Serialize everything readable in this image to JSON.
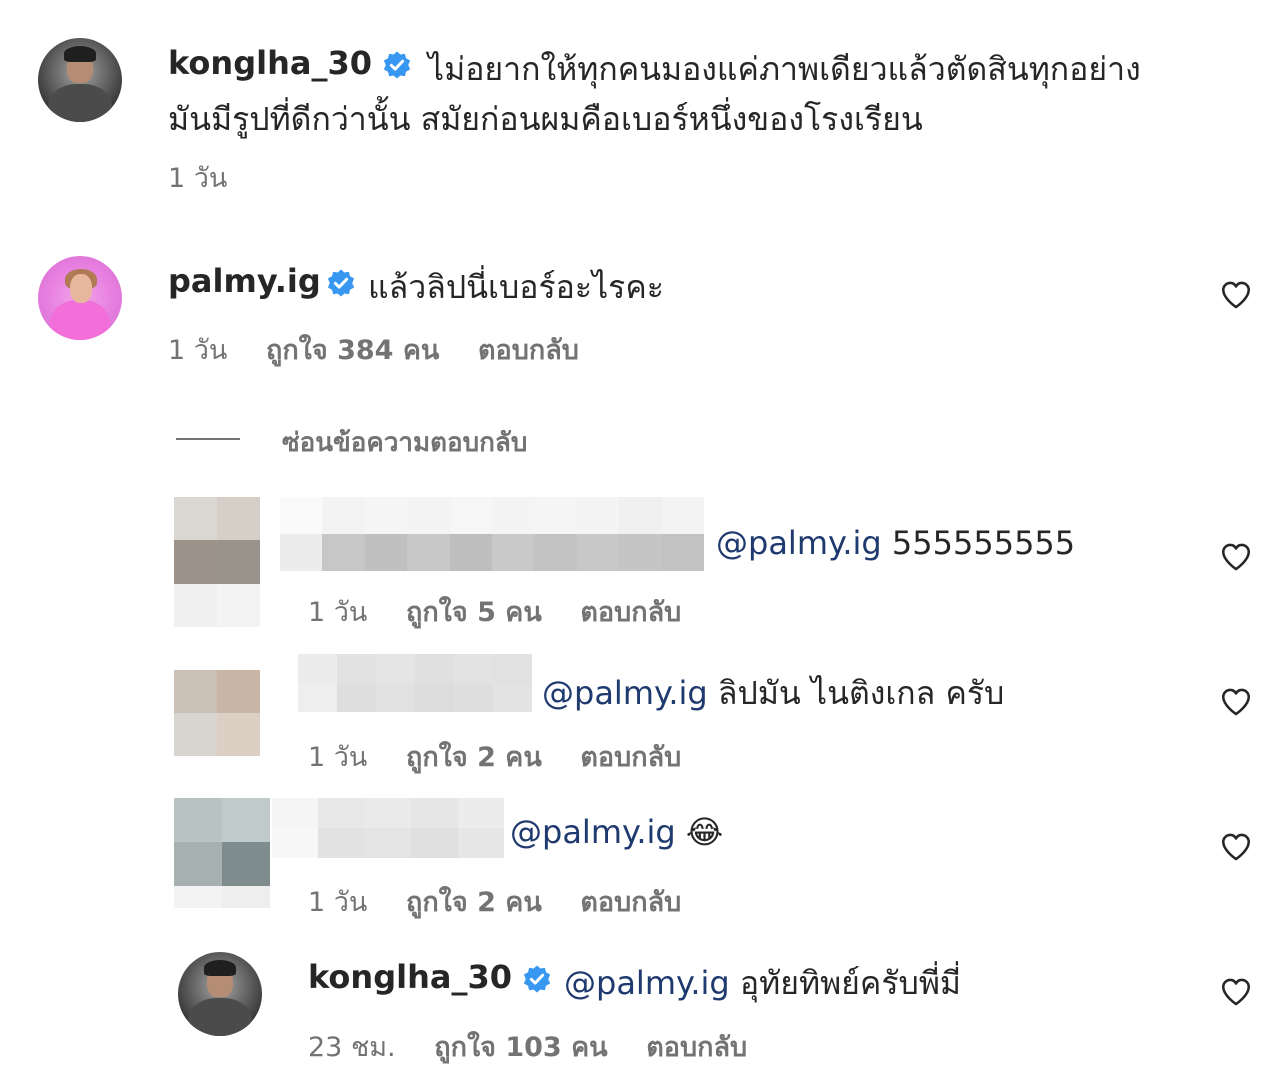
{
  "comments": [
    {
      "username": "konglha_30",
      "text_line1": "ไม่อยากให้ทุกคนมองแค่ภาพเดียวแล้วตัดสินทุกอย่าง",
      "text_line2": "มันมีรูปที่ดีกว่านั้น สมัยก่อนผมคือเบอร์หนึ่งของโรงเรียน",
      "time": "1 วัน"
    },
    {
      "username": "palmy.ig",
      "text": "แล้วลิปนี่เบอร์อะไรคะ",
      "time": "1 วัน",
      "likes": "ถูกใจ 384 คน",
      "reply": "ตอบกลับ"
    }
  ],
  "hide_replies": "ซ่อนข้อความตอบกลับ",
  "replies": [
    {
      "mention": "@palmy.ig",
      "text": "555555555",
      "time": "1 วัน",
      "likes": "ถูกใจ 5 คน",
      "reply": "ตอบกลับ"
    },
    {
      "mention": "@palmy.ig",
      "text": "ลิปมัน ไนติงเกล ครับ",
      "time": "1 วัน",
      "likes": "ถูกใจ 2 คน",
      "reply": "ตอบกลับ"
    },
    {
      "mention": "@palmy.ig",
      "text": "😂",
      "time": "1 วัน",
      "likes": "ถูกใจ 2 คน",
      "reply": "ตอบกลับ"
    },
    {
      "username": "konglha_30",
      "mention": "@palmy.ig",
      "text": "อุทัยทิพย์ครับพี่มี่",
      "time": "23 ชม.",
      "likes": "ถูกใจ 103 คน",
      "reply": "ตอบกลับ"
    }
  ],
  "colors": {
    "verified": "#3897f0",
    "mention": "#1f3a6e",
    "meta": "#737373"
  }
}
